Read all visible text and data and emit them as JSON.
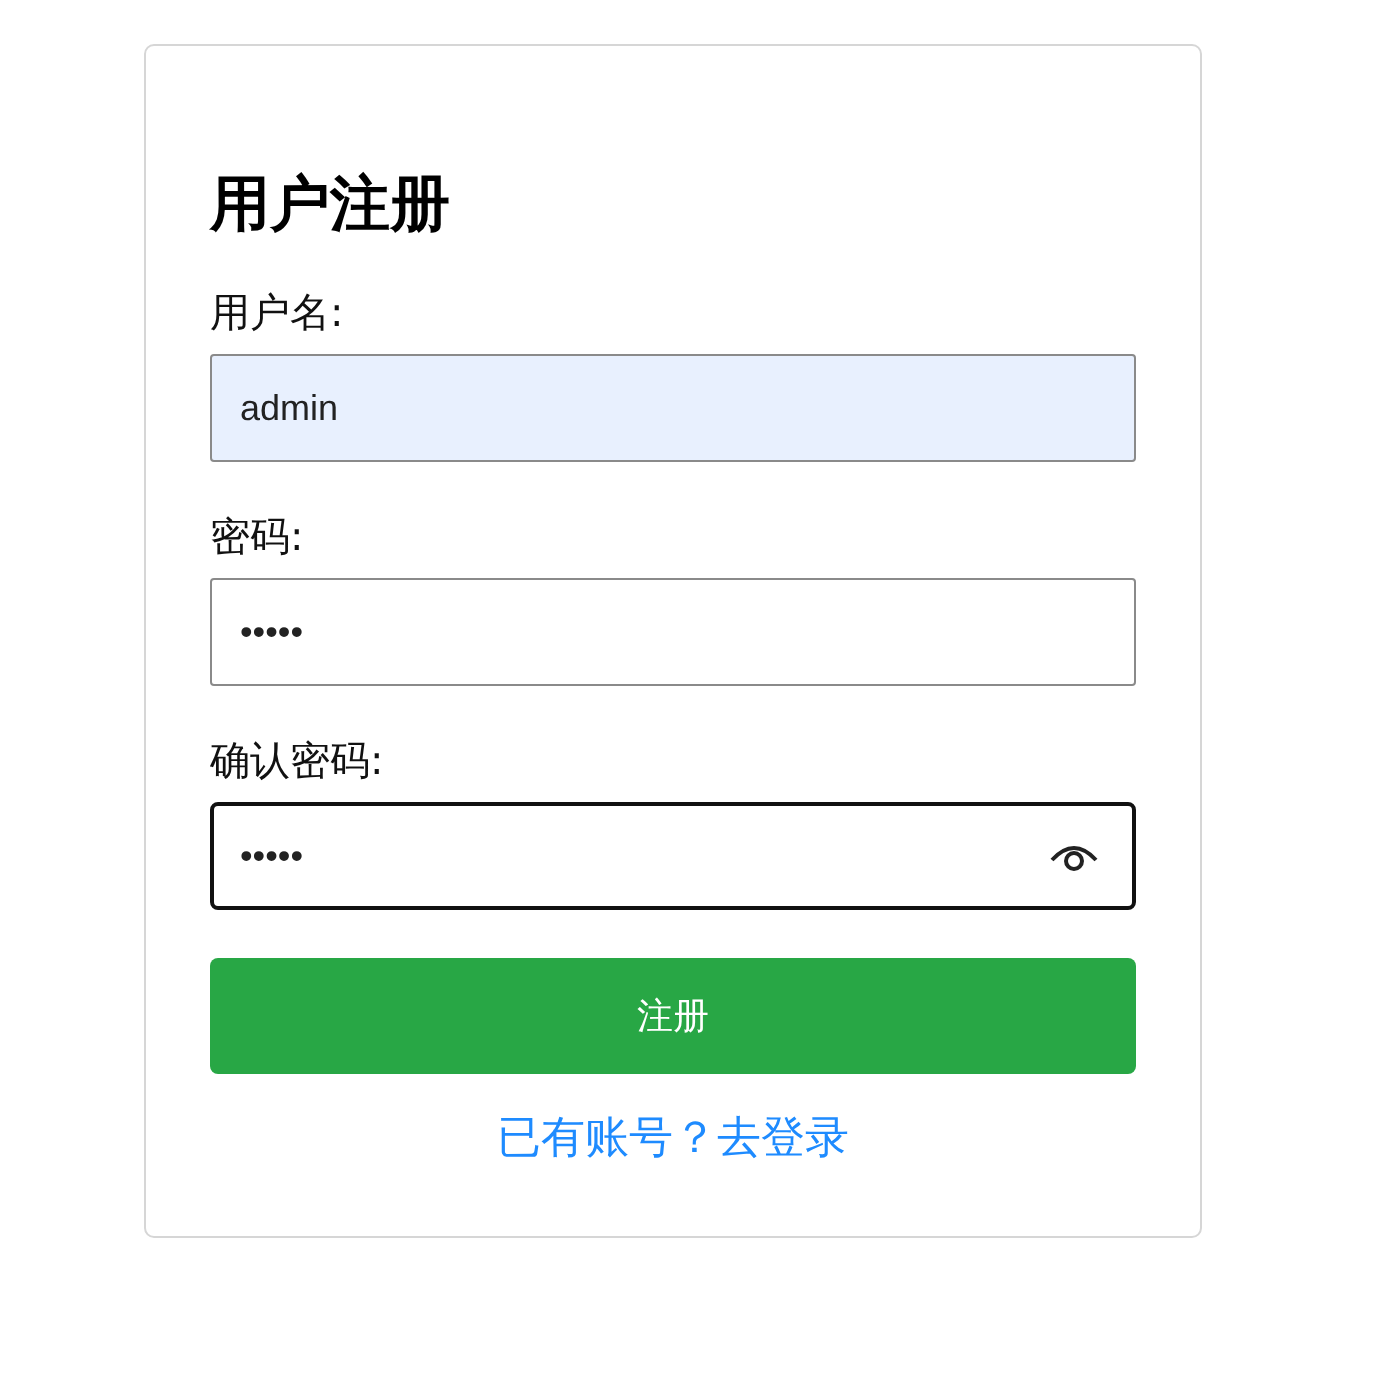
{
  "title": "用户注册",
  "fields": [
    {
      "label": "用户名:",
      "value": "admin",
      "autofilled": true,
      "focused": false,
      "reveal_toggle": false
    },
    {
      "label": "密码:",
      "value": "•••••",
      "autofilled": false,
      "focused": false,
      "reveal_toggle": false
    },
    {
      "label": "确认密码:",
      "value": "•••••",
      "autofilled": false,
      "focused": true,
      "reveal_toggle": true
    }
  ],
  "submit": "注册",
  "login_link": "已有账号？去登录"
}
